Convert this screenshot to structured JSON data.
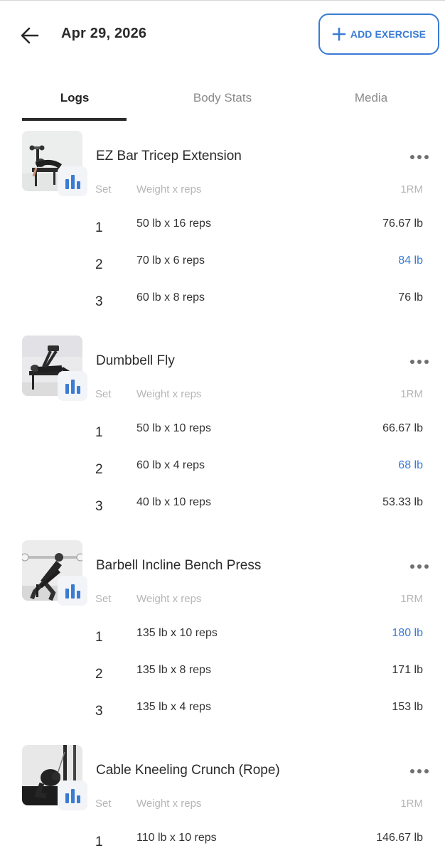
{
  "header": {
    "date": "Apr 29, 2026",
    "add_label": "ADD EXERCISE",
    "accent": "#3a7bd5"
  },
  "tabs": [
    {
      "label": "Logs",
      "active": true
    },
    {
      "label": "Body Stats",
      "active": false
    },
    {
      "label": "Media",
      "active": false
    }
  ],
  "columns": {
    "set": "Set",
    "weight": "Weight x reps",
    "rm": "1RM"
  },
  "exercises": [
    {
      "name": "EZ Bar Tricep Extension",
      "sets": [
        {
          "set": "1",
          "weight_reps": "50 lb x 16 reps",
          "rm": "76.67 lb",
          "pr": false
        },
        {
          "set": "2",
          "weight_reps": "70 lb x 6 reps",
          "rm": "84 lb",
          "pr": true
        },
        {
          "set": "3",
          "weight_reps": "60 lb x 8 reps",
          "rm": "76 lb",
          "pr": false
        }
      ]
    },
    {
      "name": "Dumbbell Fly",
      "sets": [
        {
          "set": "1",
          "weight_reps": "50 lb x 10 reps",
          "rm": "66.67 lb",
          "pr": false
        },
        {
          "set": "2",
          "weight_reps": "60 lb x 4 reps",
          "rm": "68 lb",
          "pr": true
        },
        {
          "set": "3",
          "weight_reps": "40 lb x 10 reps",
          "rm": "53.33 lb",
          "pr": false
        }
      ]
    },
    {
      "name": "Barbell Incline Bench Press",
      "sets": [
        {
          "set": "1",
          "weight_reps": "135 lb x 10 reps",
          "rm": "180 lb",
          "pr": true
        },
        {
          "set": "2",
          "weight_reps": "135 lb x 8 reps",
          "rm": "171 lb",
          "pr": false
        },
        {
          "set": "3",
          "weight_reps": "135 lb x 4 reps",
          "rm": "153 lb",
          "pr": false
        }
      ]
    },
    {
      "name": "Cable Kneeling Crunch (Rope)",
      "sets": [
        {
          "set": "1",
          "weight_reps": "110 lb x 10 reps",
          "rm": "146.67 lb",
          "pr": false
        }
      ]
    }
  ]
}
